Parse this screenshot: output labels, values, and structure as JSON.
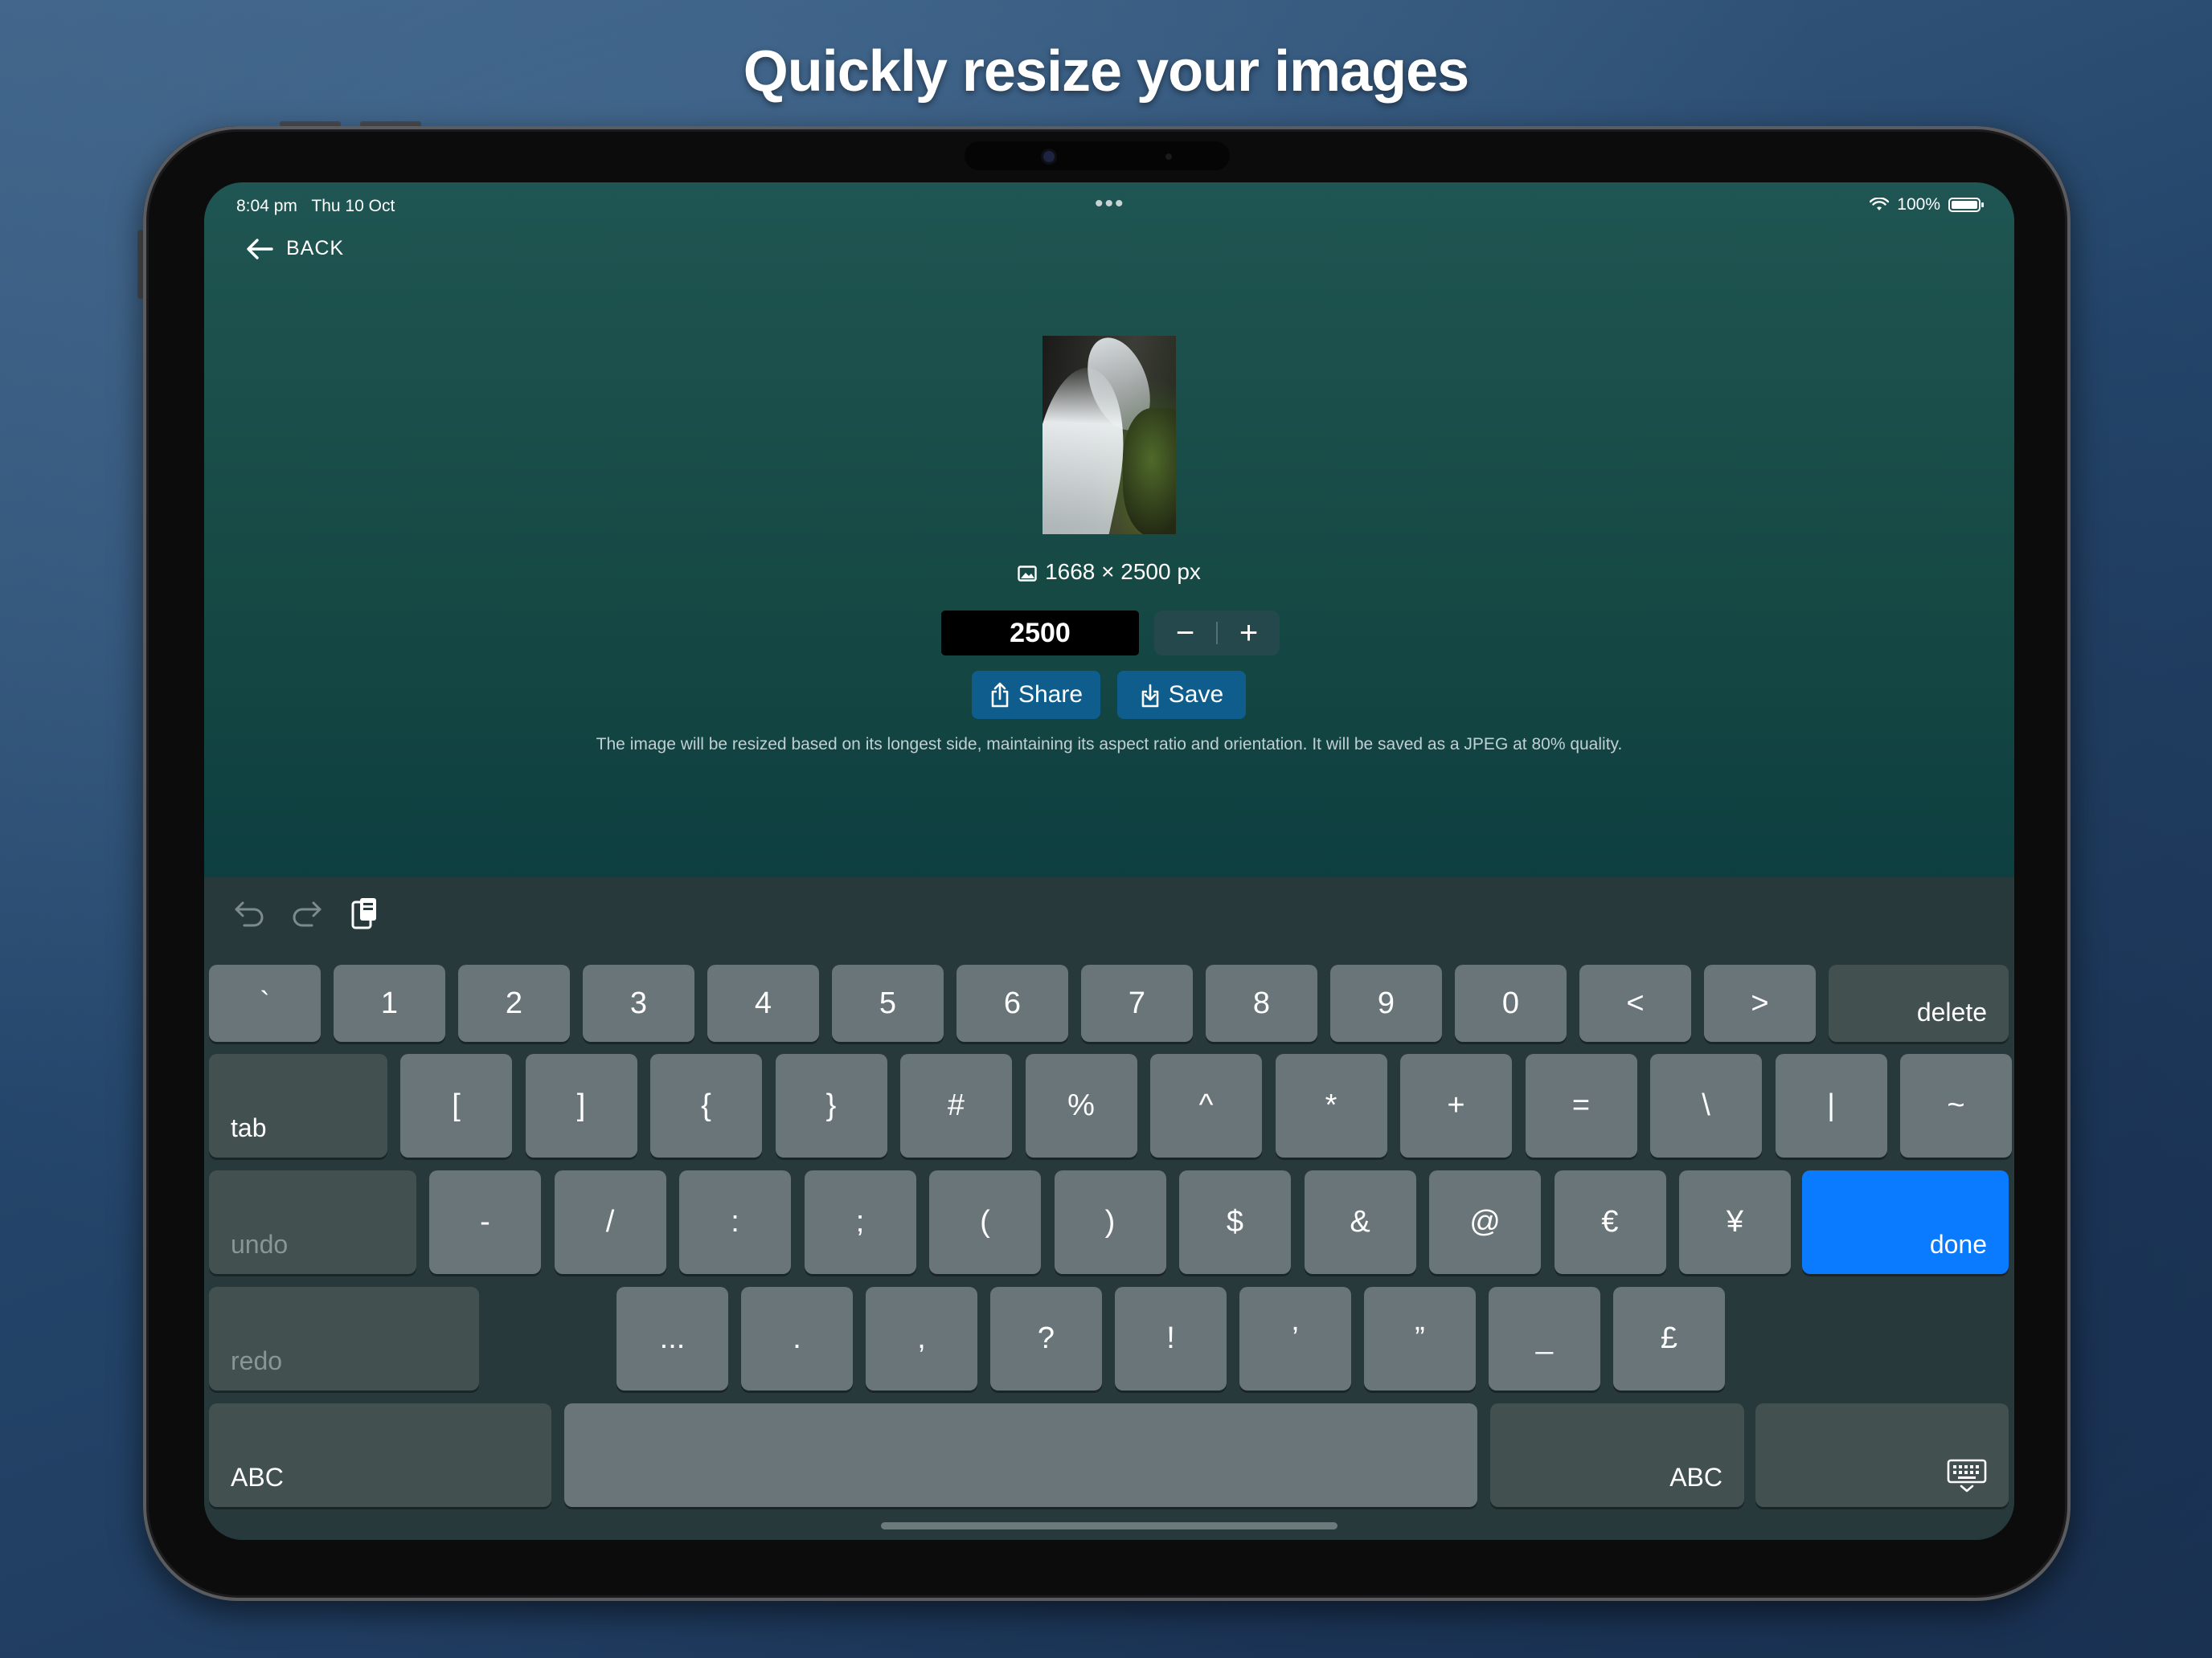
{
  "headline": "Quickly resize your images",
  "status": {
    "time": "8:04 pm",
    "date": "Thu 10 Oct",
    "multitask": "•••",
    "battery": "100%"
  },
  "nav": {
    "back_label": "BACK"
  },
  "image": {
    "dimensions": "1668 × 2500 px"
  },
  "size_input": {
    "value": "2500"
  },
  "stepper": {
    "minus": "−",
    "plus": "+"
  },
  "actions": {
    "share_label": "Share",
    "save_label": "Save"
  },
  "note": "The image will be resized based on its longest side, maintaining its aspect ratio and orientation. It will be saved as a JPEG at 80% quality.",
  "keyboard": {
    "row1": [
      "`",
      "1",
      "2",
      "3",
      "4",
      "5",
      "6",
      "7",
      "8",
      "9",
      "0",
      "<",
      ">"
    ],
    "delete": "delete",
    "tab": "tab",
    "row2": [
      "[",
      "]",
      "{",
      "}",
      "#",
      "%",
      "^",
      "*",
      "+",
      "=",
      "\\",
      "|",
      "~"
    ],
    "undo": "undo",
    "row3": [
      "-",
      "/",
      ":",
      ";",
      "(",
      ")",
      "$",
      "&",
      "@",
      "€",
      "¥"
    ],
    "done": "done",
    "redo": "redo",
    "row4": [
      "...",
      ".",
      ",",
      "?",
      "!",
      "’",
      "”",
      "_",
      "£"
    ],
    "abc_left": "ABC",
    "abc_right": "ABC"
  },
  "icons": {
    "back": "arrow-left-icon",
    "wifi": "wifi-icon",
    "battery": "battery-icon",
    "image": "image-icon",
    "share": "share-icon",
    "save": "save-icon",
    "undo": "undo-icon",
    "redo": "redo-icon",
    "paste": "clipboard-icon",
    "hide_keyboard": "keyboard-hide-icon"
  },
  "colors": {
    "done_key": "#0a7aff",
    "action_button": "#0f5d8c"
  }
}
